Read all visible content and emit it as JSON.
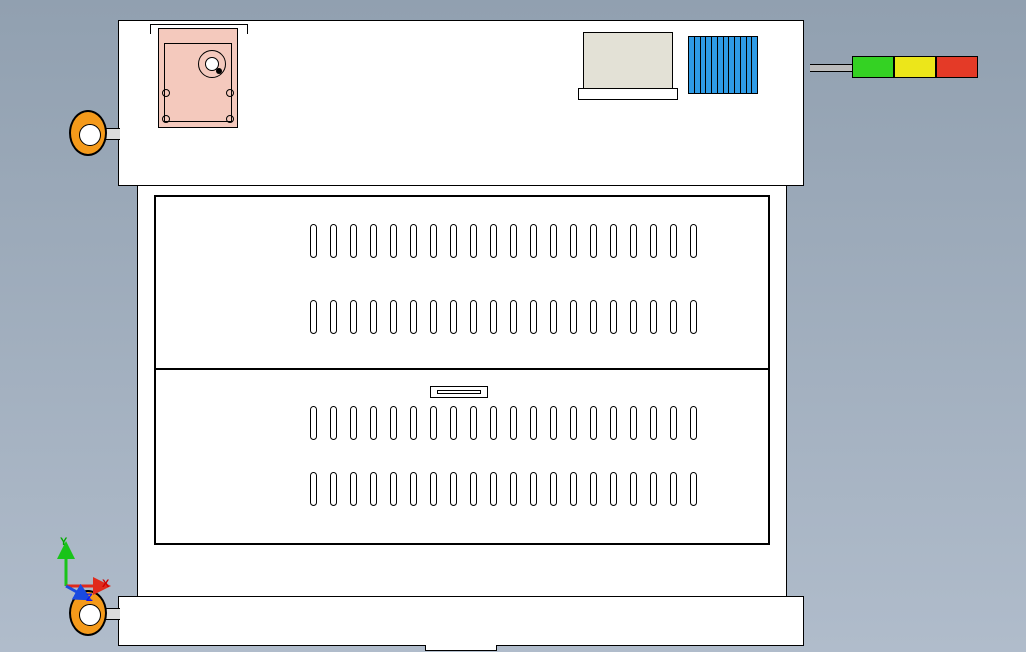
{
  "view": "Top",
  "triad": {
    "x_label": "X",
    "y_label": "Y",
    "z_label": "Z"
  },
  "signal_tower": {
    "segments": [
      "green",
      "yellow",
      "red"
    ],
    "colors": {
      "green": "#34d223",
      "yellow": "#ece61a",
      "red": "#e43a27"
    }
  },
  "components": {
    "gearbox": "pink-gearbox",
    "control_box": "control-box",
    "heatsink": "heatsink",
    "handwheel_upper": "handwheel",
    "handwheel_lower": "handwheel",
    "latch": "door-latch",
    "vent_slot_rows": 4,
    "vent_slots_per_row": 20
  }
}
